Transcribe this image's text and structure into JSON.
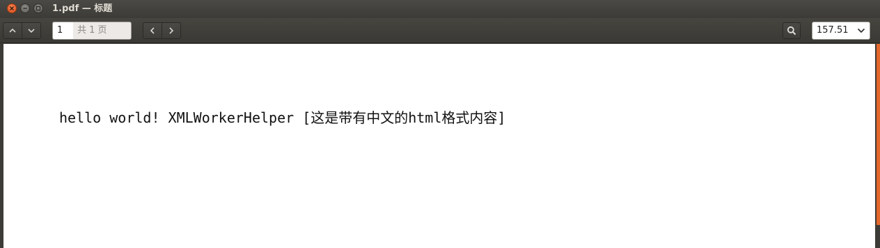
{
  "window": {
    "title": "1.pdf — 标题"
  },
  "toolbar": {
    "page_number": "1",
    "page_total": "共 1 页",
    "zoom_value": "157.51",
    "icons": {
      "page_up": "chevron-up-icon",
      "page_down": "chevron-down-icon",
      "back": "chevron-left-icon",
      "forward": "chevron-right-icon",
      "search": "search-icon",
      "zoom_dropdown": "chevron-down-icon"
    }
  },
  "document": {
    "text": "hello world! XMLWorkerHelper [这是带有中文的html格式内容]"
  },
  "colors": {
    "close_button": "#df4a16",
    "scrollbar": "#e4672c",
    "toolbar_bg": "#3c3b37"
  }
}
